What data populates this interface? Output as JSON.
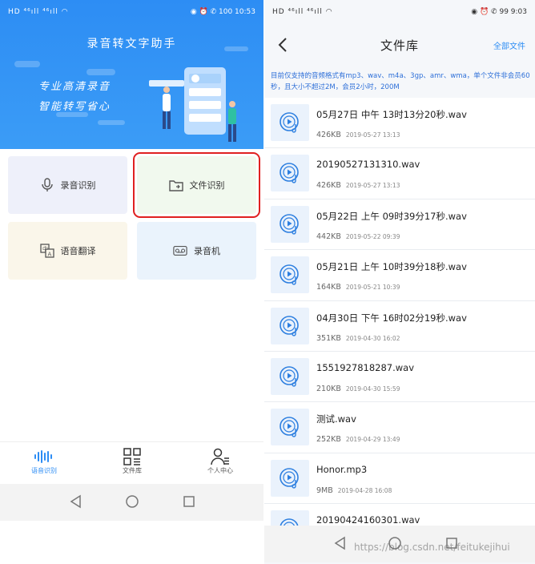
{
  "left": {
    "status": {
      "left": "HD ⁴⁶ıll ⁴⁶ıll ◠",
      "right": "◉ ⏰ ✆ 100 10:53"
    },
    "banner": {
      "title": "录音转文字助手",
      "slogan1": "专业高清录音",
      "slogan2": "智能转写省心"
    },
    "cards": [
      {
        "label": "录音识别",
        "icon": "microphone-icon",
        "bg": "#eef0fa"
      },
      {
        "label": "文件识别",
        "icon": "folder-icon",
        "bg": "#f1f9ee"
      },
      {
        "label": "语音翻译",
        "icon": "translate-icon",
        "bg": "#faf6ea"
      },
      {
        "label": "录音机",
        "icon": "recorder-icon",
        "bg": "#eaf3fc"
      }
    ],
    "nav": [
      {
        "label": "语音识别",
        "icon": "waveform-icon",
        "active": true
      },
      {
        "label": "文件库",
        "icon": "grid-list-icon",
        "active": false
      },
      {
        "label": "个人中心",
        "icon": "user-icon",
        "active": false
      }
    ]
  },
  "right": {
    "status": {
      "left": "HD ⁴⁶ıll ⁴⁶ıll ◠",
      "right": "◉ ⏰ ✆ 99 9:03"
    },
    "header": {
      "title": "文件库",
      "action": "全部文件"
    },
    "hint": "目前仅支持的音频格式有mp3、wav、m4a、3gp、amr、wma，单个文件非会员60秒，且大小不超过2M，会员2小时，200M",
    "files": [
      {
        "name": "05月27日 中午 13时13分20秒.wav",
        "size": "426KB",
        "date": "2019-05-27 13:13"
      },
      {
        "name": "20190527131310.wav",
        "size": "426KB",
        "date": "2019-05-27 13:13"
      },
      {
        "name": "05月22日 上午 09时39分17秒.wav",
        "size": "442KB",
        "date": "2019-05-22 09:39"
      },
      {
        "name": "05月21日 上午 10时39分18秒.wav",
        "size": "164KB",
        "date": "2019-05-21 10:39"
      },
      {
        "name": "04月30日 下午 16时02分19秒.wav",
        "size": "351KB",
        "date": "2019-04-30 16:02"
      },
      {
        "name": "1551927818287.wav",
        "size": "210KB",
        "date": "2019-04-30 15:59"
      },
      {
        "name": "测试.wav",
        "size": "252KB",
        "date": "2019-04-29 13:49"
      },
      {
        "name": "Honor.mp3",
        "size": "9MB",
        "date": "2019-04-28 16:08"
      },
      {
        "name": "20190424160301.wav",
        "size": "",
        "date": ""
      }
    ]
  },
  "watermark": "https://blog.csdn.net/feitukejihui",
  "colors": {
    "accent": "#2d8df4",
    "highlight": "#e02020"
  }
}
